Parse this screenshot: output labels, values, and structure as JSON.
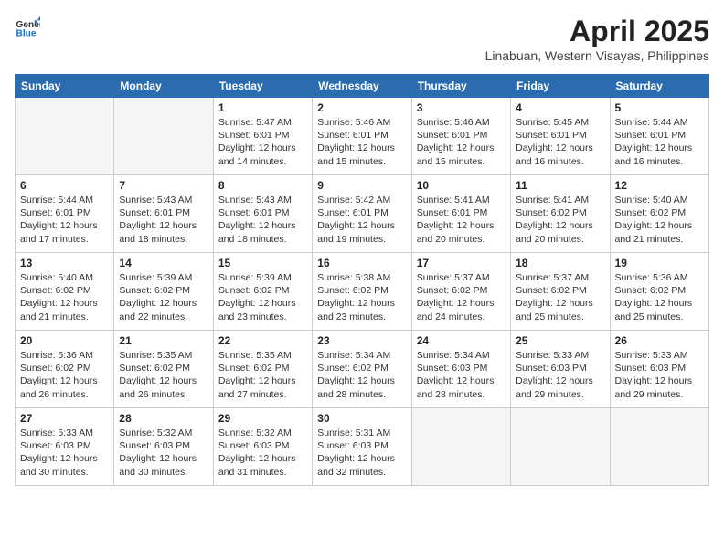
{
  "header": {
    "logo": {
      "general": "General",
      "blue": "Blue"
    },
    "month_year": "April 2025",
    "location": "Linabuan, Western Visayas, Philippines"
  },
  "weekdays": [
    "Sunday",
    "Monday",
    "Tuesday",
    "Wednesday",
    "Thursday",
    "Friday",
    "Saturday"
  ],
  "weeks": [
    [
      {
        "day": "",
        "info": ""
      },
      {
        "day": "",
        "info": ""
      },
      {
        "day": "1",
        "info": "Sunrise: 5:47 AM\nSunset: 6:01 PM\nDaylight: 12 hours and 14 minutes."
      },
      {
        "day": "2",
        "info": "Sunrise: 5:46 AM\nSunset: 6:01 PM\nDaylight: 12 hours and 15 minutes."
      },
      {
        "day": "3",
        "info": "Sunrise: 5:46 AM\nSunset: 6:01 PM\nDaylight: 12 hours and 15 minutes."
      },
      {
        "day": "4",
        "info": "Sunrise: 5:45 AM\nSunset: 6:01 PM\nDaylight: 12 hours and 16 minutes."
      },
      {
        "day": "5",
        "info": "Sunrise: 5:44 AM\nSunset: 6:01 PM\nDaylight: 12 hours and 16 minutes."
      }
    ],
    [
      {
        "day": "6",
        "info": "Sunrise: 5:44 AM\nSunset: 6:01 PM\nDaylight: 12 hours and 17 minutes."
      },
      {
        "day": "7",
        "info": "Sunrise: 5:43 AM\nSunset: 6:01 PM\nDaylight: 12 hours and 18 minutes."
      },
      {
        "day": "8",
        "info": "Sunrise: 5:43 AM\nSunset: 6:01 PM\nDaylight: 12 hours and 18 minutes."
      },
      {
        "day": "9",
        "info": "Sunrise: 5:42 AM\nSunset: 6:01 PM\nDaylight: 12 hours and 19 minutes."
      },
      {
        "day": "10",
        "info": "Sunrise: 5:41 AM\nSunset: 6:01 PM\nDaylight: 12 hours and 20 minutes."
      },
      {
        "day": "11",
        "info": "Sunrise: 5:41 AM\nSunset: 6:02 PM\nDaylight: 12 hours and 20 minutes."
      },
      {
        "day": "12",
        "info": "Sunrise: 5:40 AM\nSunset: 6:02 PM\nDaylight: 12 hours and 21 minutes."
      }
    ],
    [
      {
        "day": "13",
        "info": "Sunrise: 5:40 AM\nSunset: 6:02 PM\nDaylight: 12 hours and 21 minutes."
      },
      {
        "day": "14",
        "info": "Sunrise: 5:39 AM\nSunset: 6:02 PM\nDaylight: 12 hours and 22 minutes."
      },
      {
        "day": "15",
        "info": "Sunrise: 5:39 AM\nSunset: 6:02 PM\nDaylight: 12 hours and 23 minutes."
      },
      {
        "day": "16",
        "info": "Sunrise: 5:38 AM\nSunset: 6:02 PM\nDaylight: 12 hours and 23 minutes."
      },
      {
        "day": "17",
        "info": "Sunrise: 5:37 AM\nSunset: 6:02 PM\nDaylight: 12 hours and 24 minutes."
      },
      {
        "day": "18",
        "info": "Sunrise: 5:37 AM\nSunset: 6:02 PM\nDaylight: 12 hours and 25 minutes."
      },
      {
        "day": "19",
        "info": "Sunrise: 5:36 AM\nSunset: 6:02 PM\nDaylight: 12 hours and 25 minutes."
      }
    ],
    [
      {
        "day": "20",
        "info": "Sunrise: 5:36 AM\nSunset: 6:02 PM\nDaylight: 12 hours and 26 minutes."
      },
      {
        "day": "21",
        "info": "Sunrise: 5:35 AM\nSunset: 6:02 PM\nDaylight: 12 hours and 26 minutes."
      },
      {
        "day": "22",
        "info": "Sunrise: 5:35 AM\nSunset: 6:02 PM\nDaylight: 12 hours and 27 minutes."
      },
      {
        "day": "23",
        "info": "Sunrise: 5:34 AM\nSunset: 6:02 PM\nDaylight: 12 hours and 28 minutes."
      },
      {
        "day": "24",
        "info": "Sunrise: 5:34 AM\nSunset: 6:03 PM\nDaylight: 12 hours and 28 minutes."
      },
      {
        "day": "25",
        "info": "Sunrise: 5:33 AM\nSunset: 6:03 PM\nDaylight: 12 hours and 29 minutes."
      },
      {
        "day": "26",
        "info": "Sunrise: 5:33 AM\nSunset: 6:03 PM\nDaylight: 12 hours and 29 minutes."
      }
    ],
    [
      {
        "day": "27",
        "info": "Sunrise: 5:33 AM\nSunset: 6:03 PM\nDaylight: 12 hours and 30 minutes."
      },
      {
        "day": "28",
        "info": "Sunrise: 5:32 AM\nSunset: 6:03 PM\nDaylight: 12 hours and 30 minutes."
      },
      {
        "day": "29",
        "info": "Sunrise: 5:32 AM\nSunset: 6:03 PM\nDaylight: 12 hours and 31 minutes."
      },
      {
        "day": "30",
        "info": "Sunrise: 5:31 AM\nSunset: 6:03 PM\nDaylight: 12 hours and 32 minutes."
      },
      {
        "day": "",
        "info": ""
      },
      {
        "day": "",
        "info": ""
      },
      {
        "day": "",
        "info": ""
      }
    ]
  ]
}
